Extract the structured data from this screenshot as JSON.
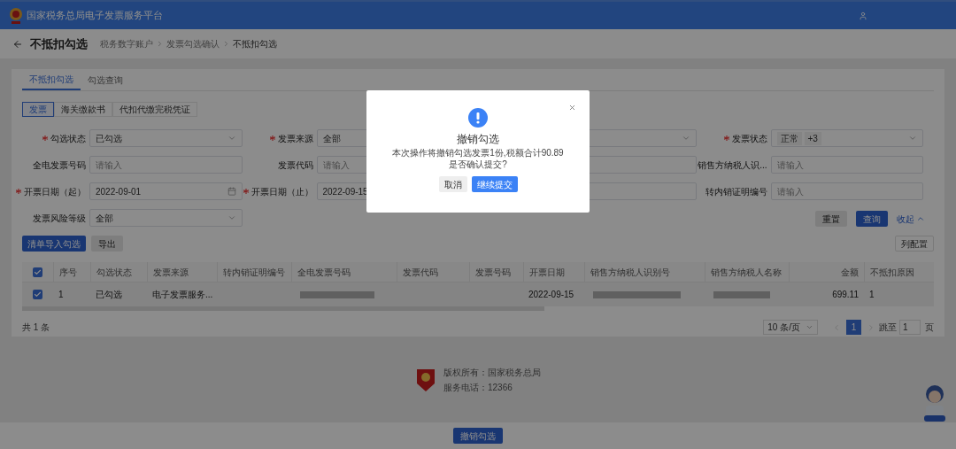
{
  "header": {
    "title": "国家税务总局电子发票服务平台"
  },
  "page": {
    "title": "不抵扣勾选",
    "breadcrumb": [
      "税务数字账户",
      "发票勾选确认",
      "不抵扣勾选"
    ]
  },
  "tabs": [
    {
      "label": "不抵扣勾选",
      "selected": true
    },
    {
      "label": "勾选查询",
      "selected": false
    }
  ],
  "ticket_types": [
    {
      "label": "发票",
      "selected": true
    },
    {
      "label": "海关缴款书",
      "selected": false
    },
    {
      "label": "代扣代缴完税凭证",
      "selected": false
    }
  ],
  "filters": [
    [
      {
        "kind": "select",
        "label": "勾选状态",
        "required": true,
        "value": "已勾选"
      },
      {
        "kind": "select_covered",
        "label": "发票来源",
        "required": true,
        "value": "全部"
      },
      {
        "kind": "select"
      },
      {
        "kind": "tags",
        "label": "发票状态",
        "required": true,
        "tags": [
          "正常",
          "+3"
        ]
      }
    ],
    [
      {
        "kind": "input",
        "label": "全电发票号码",
        "required": false,
        "placeholder": "请输入"
      },
      {
        "kind": "input",
        "label": "发票代码",
        "required": false,
        "placeholder": "请输入"
      },
      {
        "kind": "input"
      },
      {
        "kind": "input",
        "label": "销售方纳税人识...",
        "required": false,
        "placeholder": "请输入"
      }
    ],
    [
      {
        "kind": "date",
        "label": "开票日期（起）",
        "required": true,
        "value": "2022-09-01"
      },
      {
        "kind": "date_covered",
        "label": "开票日期（止）",
        "required": true,
        "value": "2022-09-15"
      },
      {
        "kind": "input"
      },
      {
        "kind": "input",
        "label": "转内销证明编号",
        "required": false,
        "placeholder": "请输入"
      }
    ],
    [
      {
        "kind": "select",
        "label": "发票风险等级",
        "required": false,
        "value": "全部"
      },
      {
        "kind": "empty"
      },
      {
        "kind": "empty"
      },
      {
        "kind": "empty"
      }
    ]
  ],
  "form_buttons": {
    "reset": "重置",
    "search": "查询",
    "collapse": "收起"
  },
  "actions": {
    "import": "清单导入勾选",
    "export": "导出",
    "columns": "列配置"
  },
  "table": {
    "header_checked": true,
    "columns": [
      "序号",
      "勾选状态",
      "发票来源",
      "转内销证明编号",
      "全电发票号码",
      "发票代码",
      "发票号码",
      "开票日期",
      "销售方纳税人识别号",
      "销售方纳税人名称",
      "金额",
      "不抵扣原因"
    ],
    "rows": [
      {
        "checked": true,
        "cells": [
          {
            "kind": "text",
            "text": "1"
          },
          {
            "kind": "text",
            "text": "已勾选"
          },
          {
            "kind": "text",
            "text": "电子发票服务..."
          },
          {
            "kind": "empty"
          },
          {
            "kind": "redacted"
          },
          {
            "kind": "empty"
          },
          {
            "kind": "empty"
          },
          {
            "kind": "text",
            "text": "2022-09-15"
          },
          {
            "kind": "redacted"
          },
          {
            "kind": "redacted"
          },
          {
            "kind": "amount",
            "text": "699.11"
          },
          {
            "kind": "text",
            "text": "1"
          }
        ]
      }
    ]
  },
  "pagination": {
    "total": "共 1 条",
    "page_size": "10 条/页",
    "pages": [
      {
        "label": "1",
        "selected": true
      }
    ],
    "jump_label": "跳至",
    "jump_value": "1",
    "page_unit": "页"
  },
  "footer": {
    "copyright": "版权所有：国家税务总局",
    "phone": "服务电话：12366"
  },
  "bottom_button": "撤销勾选",
  "dialog": {
    "title": "撤销勾选",
    "lines": [
      "本次操作将撤销勾选发票1份,税额合计90.89",
      "是否确认提交?"
    ],
    "cancel": "取消",
    "confirm": "继续提交"
  }
}
